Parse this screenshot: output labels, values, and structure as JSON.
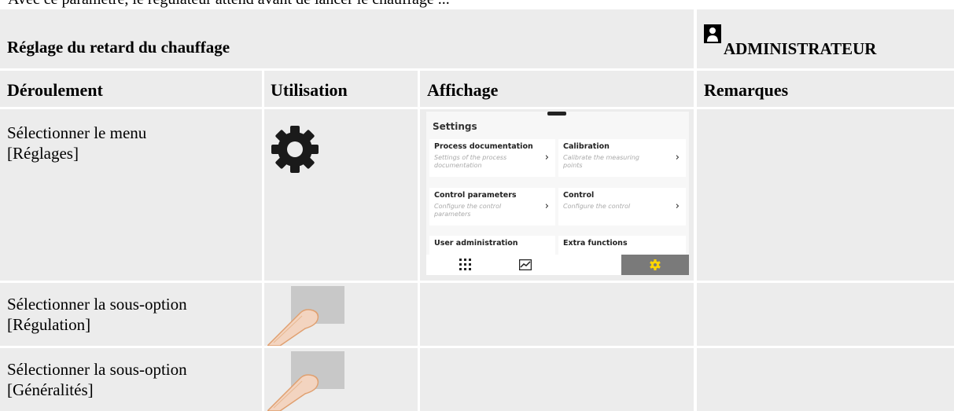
{
  "top_fragment": "Avec ce paramètre, le régulateur attend avant de lancer le chauffage ...",
  "header": {
    "title": "Réglage du retard du chauffage",
    "role": "ADMINISTRATEUR",
    "role_icon": "user-icon"
  },
  "columns": [
    "Déroulement",
    "Utilisation",
    "Affichage",
    "Remarques"
  ],
  "rows": [
    {
      "step": "Sélectionner le menu\n[Réglages]",
      "usage_icon": "gear-icon",
      "remarks": ""
    },
    {
      "step": "Sélectionner la sous-option\n[Régulation]",
      "usage_icon": "finger-tap-icon",
      "remarks": ""
    },
    {
      "step": "Sélectionner la sous-option\n[Généralités]",
      "usage_icon": "finger-tap-icon",
      "remarks": ""
    }
  ],
  "screen": {
    "title": "Settings",
    "tiles": [
      {
        "title": "Process documentation",
        "desc": "Settings of the process documentation"
      },
      {
        "title": "Calibration",
        "desc": "Calibrate the measuring points"
      },
      {
        "title": "Control parameters",
        "desc": "Configure the control parameters"
      },
      {
        "title": "Control",
        "desc": "Configure the control"
      },
      {
        "title": "User administration",
        "desc": ""
      },
      {
        "title": "Extra functions",
        "desc": ""
      }
    ],
    "nav": [
      "grid-icon",
      "chart-icon",
      "settings-icon"
    ],
    "accent": "#ffd600",
    "active_nav_bg": "#7a7a7a"
  }
}
